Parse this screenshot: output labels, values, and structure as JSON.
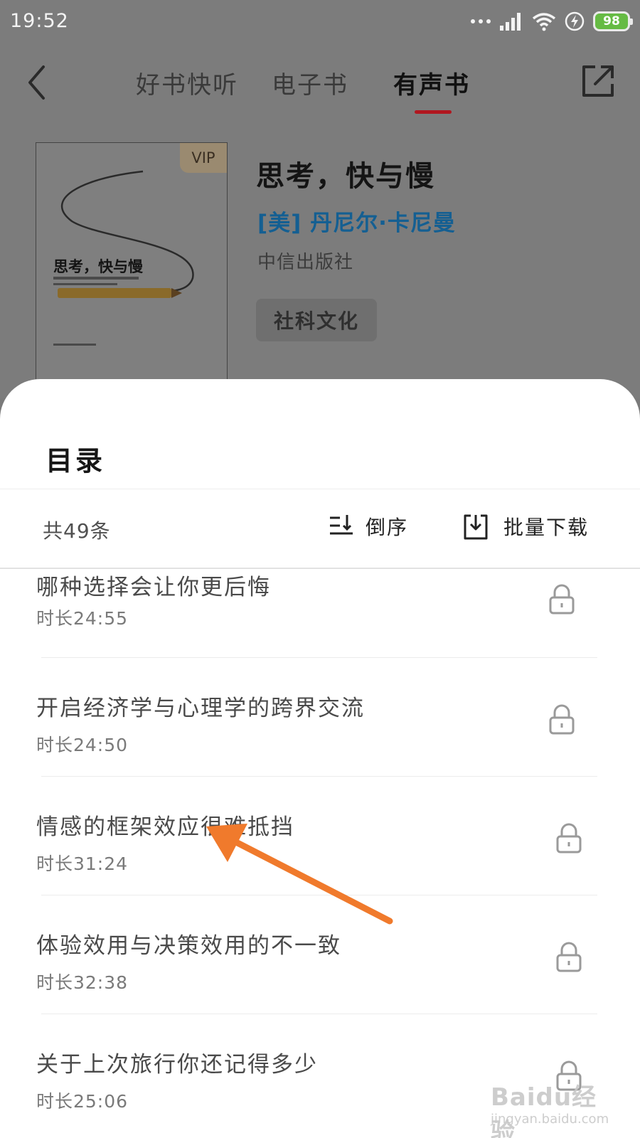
{
  "status_bar": {
    "time": "19:52",
    "battery": "98",
    "icons": [
      "more-dots-icon",
      "signal-icon",
      "wifi-icon",
      "charging-icon",
      "battery-icon"
    ]
  },
  "nav": {
    "tabs": [
      {
        "label": "好书快听",
        "active": false
      },
      {
        "label": "电子书",
        "active": false
      },
      {
        "label": "有声书",
        "active": true
      }
    ]
  },
  "book": {
    "cover_badge": "VIP",
    "cover_title": "思考，快与慢",
    "title": "思考，快与慢",
    "author": "[美] 丹尼尔·卡尼曼",
    "publisher": "中信出版社",
    "tag": "社科文化"
  },
  "catalog": {
    "title": "目录",
    "count_label": "共49条",
    "sort_label": "倒序",
    "download_label": "批量下载",
    "chapters": [
      {
        "title": "哪种选择会让你更后悔",
        "duration": "时长24:55",
        "locked": true
      },
      {
        "title": "开启经济学与心理学的跨界交流",
        "duration": "时长24:50",
        "locked": true
      },
      {
        "title": "情感的框架效应很难抵挡",
        "duration": "时长31:24",
        "locked": true
      },
      {
        "title": "体验效用与决策效用的不一致",
        "duration": "时长32:38",
        "locked": true
      },
      {
        "title": "关于上次旅行你还记得多少",
        "duration": "时长25:06",
        "locked": true
      }
    ]
  },
  "watermark": {
    "text": "Baidu经验",
    "url": "jingyan.baidu.com"
  },
  "colors": {
    "accent": "#b1171f",
    "author": "#145f92",
    "annotation_arrow": "#f07a2c",
    "battery": "#66bb44"
  }
}
